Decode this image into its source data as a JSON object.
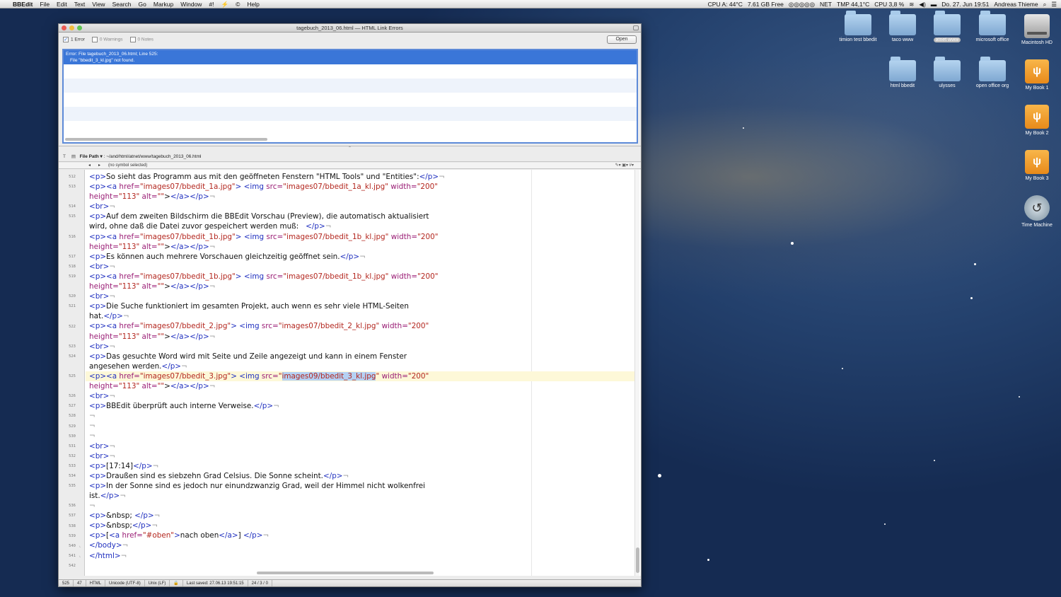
{
  "menubar": {
    "app": "BBEdit",
    "menus": [
      "File",
      "Edit",
      "Text",
      "View",
      "Search",
      "Go",
      "Markup",
      "Window",
      "#!",
      "Help"
    ],
    "status": [
      "CPU A: 44°C",
      "7.61 GB Free",
      "NET",
      "TMP 44,1°C",
      "CPU 3,8 %",
      "Do. 27. Jun 19:51",
      "Andreas Thieme"
    ]
  },
  "desktop": {
    "icons": [
      {
        "label": "timion test bbedit",
        "kind": "folder"
      },
      {
        "label": "taco www",
        "kind": "folder"
      },
      {
        "label": "atnet www",
        "kind": "folder"
      },
      {
        "label": "microsoft office",
        "kind": "folder"
      },
      {
        "label": "Macintosh HD",
        "kind": "hd-icon"
      },
      {
        "label": "html bbedit",
        "kind": "folder"
      },
      {
        "label": "ulysses",
        "kind": "folder"
      },
      {
        "label": "open office org",
        "kind": "folder"
      },
      {
        "label": "My Book 1",
        "kind": "external-drive-icon"
      },
      {
        "label": "My Book 2",
        "kind": "external-drive-icon"
      },
      {
        "label": "My Book 3",
        "kind": "external-drive-icon"
      },
      {
        "label": "Time Machine",
        "kind": "time-machine-icon"
      }
    ]
  },
  "window": {
    "title": "tagebuch_2013_06.html — HTML Link Errors",
    "filters": {
      "errors": "1 Error",
      "warnings": "0 Warnings",
      "notes": "0 Notes"
    },
    "open_label": "Open",
    "error": {
      "line1": "Error: File tagebuch_2013_06.html; Line 525:",
      "line2": "File \"bbedit_3_kl.jpg\" not found."
    },
    "file_path_label": "File Path ▾",
    "file_path": ": ~/and/html/atnet/www/tagebuch_2013_06.html",
    "symbol": "(no symbol selected)",
    "status": {
      "line": "525",
      "col": "47",
      "language": "HTML",
      "encoding": "Unicode (UTF-8)",
      "line_endings": "Unix (LF)",
      "last_saved": "Last saved: 27.06.13 19:51:15",
      "counts": "24 / 3 / 0"
    }
  },
  "editor": {
    "current_line": 525,
    "lines": [
      {
        "n": "512",
        "text": "<p>So sieht das Programm aus mit den geöffneten Fenstern \"HTML Tools\" und \"Entities\":</p>¬"
      },
      {
        "n": "513",
        "text": "<p><a href=\"images07/bbedit_1a.jpg\"> <img src=\"images07/bbedit_1a_kl.jpg\" width=\"200\""
      },
      {
        "n": "",
        "text": "height=\"113\" alt=\"\"></a></p>¬"
      },
      {
        "n": "514",
        "text": "<br>¬"
      },
      {
        "n": "515",
        "text": "<p>Auf dem zweiten Bildschirm die BBEdit Vorschau (Preview), die automatisch aktualisiert"
      },
      {
        "n": "",
        "text": "wird, ohne daß die Datei zuvor gespeichert werden muß:   </p>¬"
      },
      {
        "n": "516",
        "text": "<p><a href=\"images07/bbedit_1b.jpg\"> <img src=\"images07/bbedit_1b_kl.jpg\" width=\"200\""
      },
      {
        "n": "",
        "text": "height=\"113\" alt=\"\"></a></p>¬"
      },
      {
        "n": "517",
        "text": "<p>Es können auch mehrere Vorschauen gleichzeitig geöffnet sein.</p>¬"
      },
      {
        "n": "518",
        "text": "<br>¬"
      },
      {
        "n": "519",
        "text": "<p><a href=\"images07/bbedit_1b.jpg\"> <img src=\"images07/bbedit_1b_kl.jpg\" width=\"200\""
      },
      {
        "n": "",
        "text": "height=\"113\" alt=\"\"></a></p>¬"
      },
      {
        "n": "520",
        "text": "<br>¬"
      },
      {
        "n": "521",
        "text": "<p>Die Suche funktioniert im gesamten Projekt, auch wenn es sehr viele HTML-Seiten"
      },
      {
        "n": "",
        "text": "hat.</p>¬"
      },
      {
        "n": "522",
        "text": "<p><a href=\"images07/bbedit_2.jpg\"> <img src=\"images07/bbedit_2_kl.jpg\" width=\"200\""
      },
      {
        "n": "",
        "text": "height=\"113\" alt=\"\"></a></p>¬"
      },
      {
        "n": "523",
        "text": "<br>¬"
      },
      {
        "n": "524",
        "text": "<p>Das gesuchte Word wird mit Seite und Zeile angezeigt und kann in einem Fenster"
      },
      {
        "n": "",
        "text": "angesehen werden.</p>¬"
      },
      {
        "n": "525",
        "text": "<p><a href=\"images07/bbedit_3.jpg\"> <img src=\"images09/bbedit_3_kl.jpg\" width=\"200\"",
        "selected": "images09/bbedit_3_kl.jpg"
      },
      {
        "n": "",
        "text": "height=\"113\" alt=\"\"></a></p>¬"
      },
      {
        "n": "526",
        "text": "<br>¬"
      },
      {
        "n": "527",
        "text": "<p>BBEdit überprüft auch interne Verweise.</p>¬"
      },
      {
        "n": "528",
        "text": "¬"
      },
      {
        "n": "529",
        "text": "¬"
      },
      {
        "n": "530",
        "text": "¬"
      },
      {
        "n": "531",
        "text": "<br>¬"
      },
      {
        "n": "532",
        "text": "<br>¬"
      },
      {
        "n": "533",
        "text": "<p>[17:14]</p>¬"
      },
      {
        "n": "534",
        "text": "<p>Draußen sind es siebzehn Grad Celsius. Die Sonne scheint.</p>¬"
      },
      {
        "n": "535",
        "text": "<p>In der Sonne sind es jedoch nur einundzwanzig Grad, weil der Himmel nicht wolkenfrei"
      },
      {
        "n": "",
        "text": "ist.</p>¬"
      },
      {
        "n": "536",
        "text": "¬"
      },
      {
        "n": "537",
        "text": "<p>&nbsp; </p>¬"
      },
      {
        "n": "538",
        "text": "<p>&nbsp;</p>¬"
      },
      {
        "n": "539",
        "text": "<p>[<a href=\"#oben\">nach oben</a>] </p>¬"
      },
      {
        "n": "540",
        "text": "</body>¬"
      },
      {
        "n": "541",
        "text": "</html>¬"
      },
      {
        "n": "542",
        "text": ""
      }
    ]
  }
}
